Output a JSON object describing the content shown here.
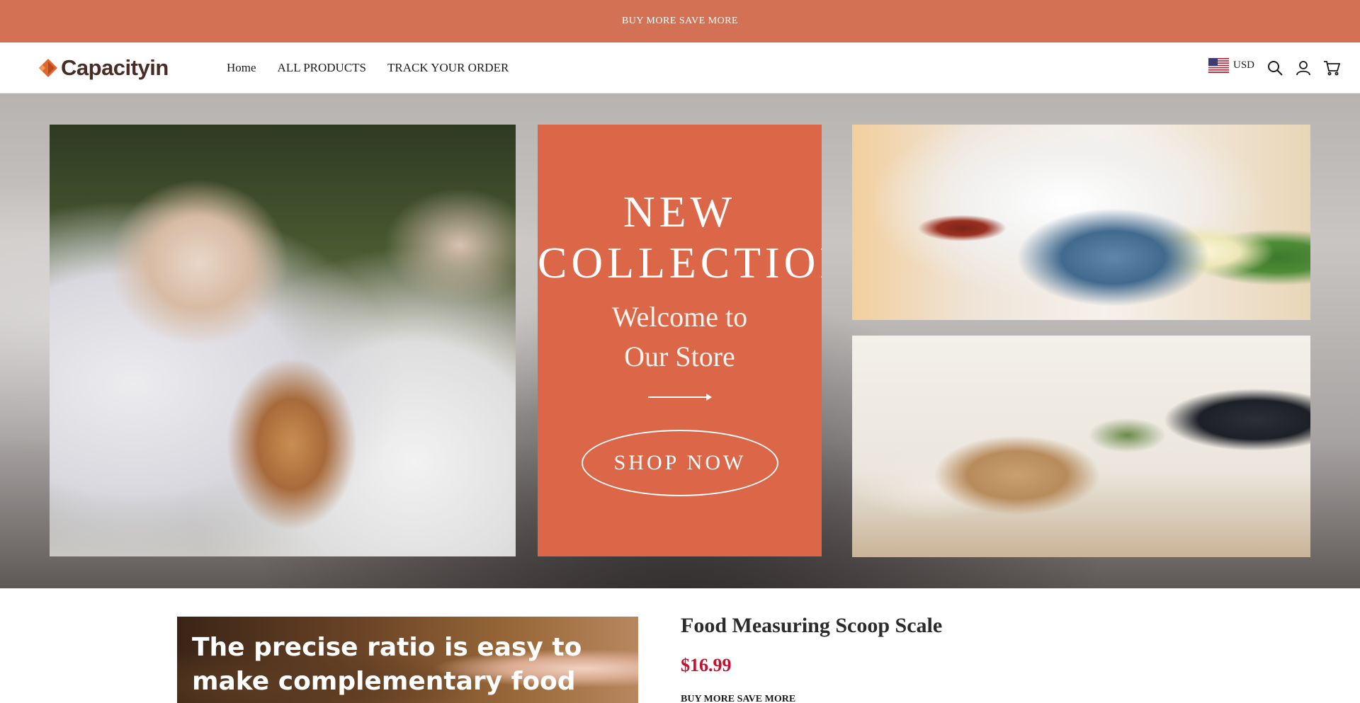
{
  "announcement": {
    "text": "BUY MORE SAVE MORE"
  },
  "header": {
    "logo_text": "Capacityin",
    "nav": [
      {
        "label": "Home"
      },
      {
        "label": "ALL PRODUCTS"
      },
      {
        "label": "TRACK YOUR ORDER"
      }
    ],
    "currency": "USD",
    "icons": [
      "us-flag-icon",
      "search-icon",
      "account-icon",
      "cart-icon"
    ]
  },
  "hero": {
    "promo": {
      "title_line1": "NEW",
      "title_line2": "COLLECTION",
      "subtitle_line1": "Welcome to",
      "subtitle_line2": "Our Store",
      "button": "SHOP NOW"
    }
  },
  "product": {
    "image_text_line1": "The precise ratio is easy to",
    "image_text_line2": "make complementary food",
    "title": "Food Measuring Scoop Scale",
    "price": "$16.99",
    "note": "BUY MORE SAVE MORE"
  },
  "colors": {
    "announcement_bg": "#d27153",
    "promo_bg": "#dc6748",
    "price": "#c8102e",
    "logo_text": "#4a2c26",
    "logo_mark": "#e0662c"
  }
}
